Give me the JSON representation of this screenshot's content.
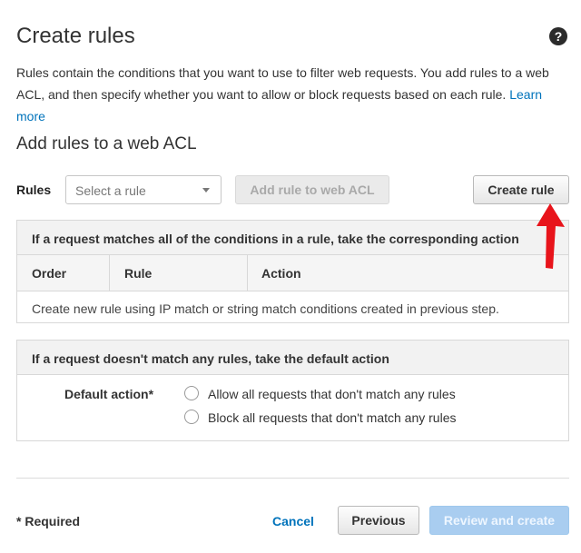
{
  "header": {
    "title": "Create rules",
    "help_icon": "?"
  },
  "description": {
    "text": "Rules contain the conditions that you want to use to filter web requests. You add rules to a web ACL, and then specify whether you want to allow or block requests based on each rule. ",
    "link": "Learn more"
  },
  "add_rules": {
    "title": "Add rules to a web ACL",
    "rules_label": "Rules",
    "select_placeholder": "Select a rule",
    "add_button": "Add rule to web ACL",
    "create_button": "Create rule"
  },
  "match_panel": {
    "header": "If a request matches all of the conditions in a rule, take the corresponding action",
    "columns": [
      "Order",
      "Rule",
      "Action"
    ],
    "empty_message": "Create new rule using IP match or string match conditions created in previous step."
  },
  "default_panel": {
    "header": "If a request doesn't match any rules, take the default action",
    "label": "Default action*",
    "options": [
      "Allow all requests that don't match any rules",
      "Block all requests that don't match any rules"
    ]
  },
  "footer": {
    "required": "* Required",
    "cancel": "Cancel",
    "previous": "Previous",
    "review": "Review and create"
  },
  "colors": {
    "link": "#0073bb",
    "primary_disabled": "#a9cdf0",
    "annotation_arrow": "#e8141b"
  }
}
